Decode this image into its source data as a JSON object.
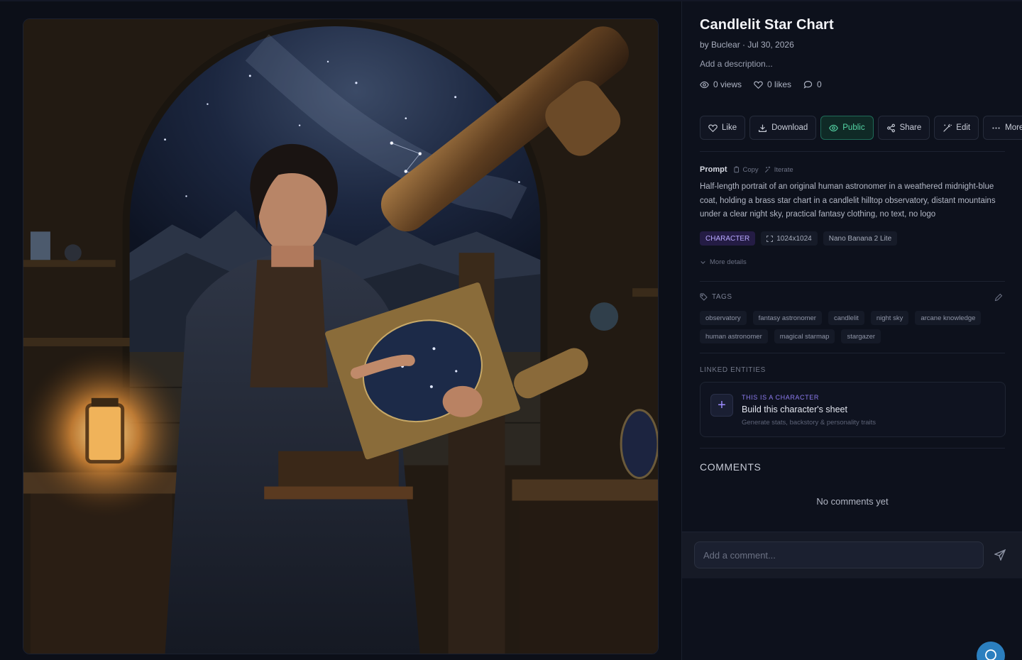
{
  "image": {
    "alt": "Candlelit Star Chart"
  },
  "details": {
    "title": "Candlelit Star Chart",
    "byline": "by Buclear · Jul 30, 2026",
    "description_placeholder": "Add a description...",
    "stats": {
      "views": "0 views",
      "likes": "0 likes",
      "comments": "0"
    }
  },
  "actions": {
    "like": "Like",
    "download": "Download",
    "public": "Public",
    "share": "Share",
    "edit": "Edit",
    "more": "More"
  },
  "prompt": {
    "label": "Prompt",
    "copy": "Copy",
    "iterate": "Iterate",
    "text": "Half-length portrait of an original human astronomer in a weathered midnight-blue coat, holding a brass star chart in a candlelit hilltop observatory, distant mountains under a clear night sky, practical fantasy clothing, no text, no logo"
  },
  "meta_chips": {
    "category": "CHARACTER",
    "size": "1024x1024",
    "model": "Nano Banana 2 Lite"
  },
  "more_details": "More details",
  "tags": {
    "label": "TAGS",
    "items": [
      "observatory",
      "fantasy astronomer",
      "candlelit",
      "night sky",
      "arcane knowledge",
      "human astronomer",
      "magical starmap",
      "stargazer"
    ]
  },
  "linked": {
    "label": "LINKED ENTITIES",
    "kicker": "THIS IS A CHARACTER",
    "title": "Build this character's sheet",
    "subtitle": "Generate stats, backstory & personality traits"
  },
  "comments": {
    "label": "COMMENTS",
    "empty": "No comments yet",
    "placeholder": "Add a comment..."
  },
  "colors": {
    "accent_public": "#55d6a6",
    "accent_character": "#b8a8ff",
    "fab": "#2b7fbf"
  },
  "icons": [
    "eye-icon",
    "heart-icon",
    "comment-icon",
    "download-icon",
    "share-icon",
    "edit-wand-icon",
    "more-dots-icon",
    "copy-icon",
    "sparkle-icon",
    "expand-icon",
    "chevron-down-icon",
    "tag-icon",
    "pencil-icon",
    "plus-icon",
    "send-icon",
    "chat-icon"
  ]
}
